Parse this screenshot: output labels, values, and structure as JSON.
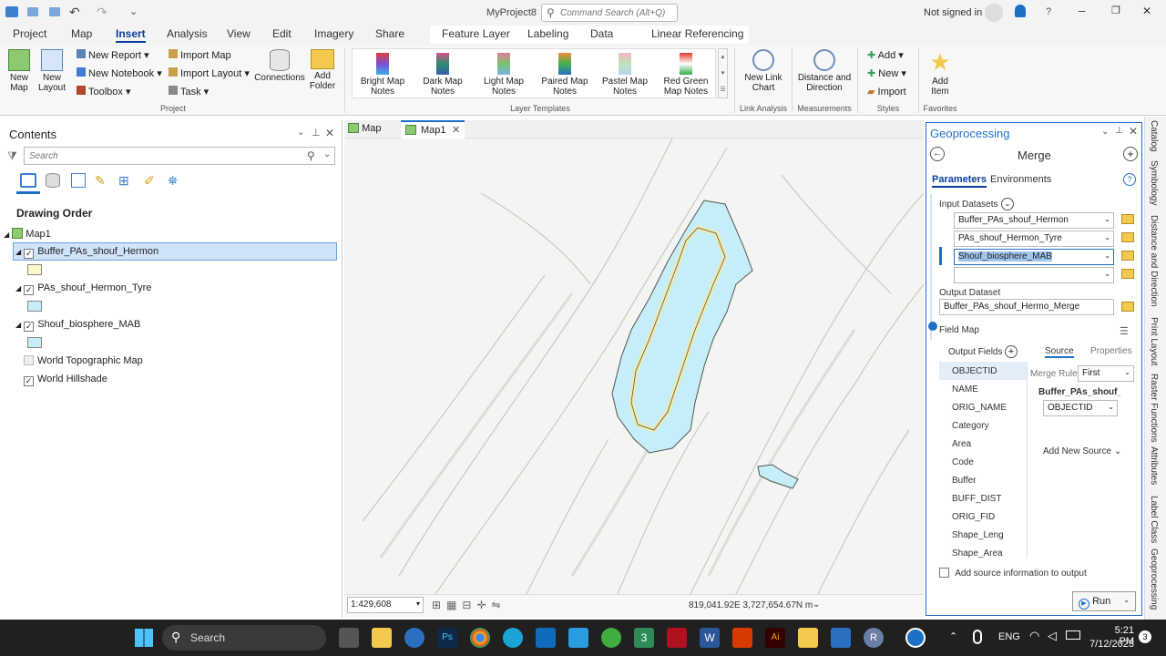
{
  "titlebar": {
    "project": "MyProject8",
    "search_placeholder": "Command Search (Alt+Q)",
    "signin": "Not signed in",
    "help": "?"
  },
  "tabs": [
    {
      "label": "Project"
    },
    {
      "label": "Map"
    },
    {
      "label": "Insert"
    },
    {
      "label": "Analysis"
    },
    {
      "label": "View"
    },
    {
      "label": "Edit"
    },
    {
      "label": "Imagery"
    },
    {
      "label": "Share"
    },
    {
      "label": "Feature Layer"
    },
    {
      "label": "Labeling"
    },
    {
      "label": "Data"
    },
    {
      "label": "Linear Referencing"
    }
  ],
  "ribbon": {
    "new_map": "New Map",
    "new_layout": "New Layout",
    "new_report": "New Report",
    "new_notebook": "New Notebook",
    "toolbox": "Toolbox",
    "import_map": "Import Map",
    "import_layout": "Import Layout",
    "task": "Task",
    "connections": "Connections",
    "add_folder": "Add Folder",
    "templates": [
      "Bright Map Notes",
      "Dark Map Notes",
      "Light Map Notes",
      "Paired Map Notes",
      "Pastel Map Notes",
      "Red Green Map Notes"
    ],
    "new_link_chart": "New Link Chart",
    "distance_direction": "Distance and Direction",
    "add": "Add",
    "new": "New",
    "import": "Import",
    "add_item": "Add Item",
    "groups": {
      "project": "Project",
      "layer_templates": "Layer Templates",
      "link_analysis": "Link Analysis",
      "measurements": "Measurements",
      "styles": "Styles",
      "favorites": "Favorites"
    }
  },
  "contents": {
    "title": "Contents",
    "search_placeholder": "Search",
    "drawing_order": "Drawing Order",
    "map_name": "Map1",
    "layers": [
      {
        "name": "Buffer_PAs_shouf_Hermon",
        "checked": "✓",
        "color": "#fdf8c9"
      },
      {
        "name": "PAs_shouf_Hermon_Tyre",
        "checked": "✓",
        "color": "#c6eef8"
      },
      {
        "name": "Shouf_biosphere_MAB",
        "checked": "✓",
        "color": "#c6eef8"
      },
      {
        "name": "World Topographic Map",
        "checked": ""
      },
      {
        "name": "World Hillshade",
        "checked": "✓"
      }
    ]
  },
  "map": {
    "tabs": [
      {
        "label": "Map"
      },
      {
        "label": "Map1"
      }
    ],
    "close_icon": "✕",
    "scale": "1:429,608",
    "coords": "819,041.92E 3,727,654.67N m"
  },
  "geo": {
    "title": "Geoprocessing",
    "tool": "Merge",
    "tab_params": "Parameters",
    "tab_env": "Environments",
    "input_label": "Input Datasets",
    "inputs": [
      "Buffer_PAs_shouf_Hermon",
      "PAs_shouf_Hermon_Tyre",
      "Shouf_biosphere_MAB",
      ""
    ],
    "output_label": "Output Dataset",
    "output_value": "Buffer_PAs_shouf_Hermo_Merge",
    "field_map": "Field Map",
    "output_fields": "Output Fields",
    "source": "Source",
    "properties": "Properties",
    "fields": [
      "OBJECTID",
      "NAME",
      "ORIG_NAME",
      "Category",
      "Area",
      "Code",
      "Buffer",
      "BUFF_DIST",
      "ORIG_FID",
      "Shape_Leng",
      "Shape_Area"
    ],
    "merge_rule_label": "Merge Rule",
    "merge_rule": "First",
    "source_layer": "Buffer_PAs_shouf_H",
    "source_field": "OBJECTID",
    "add_new_source": "Add New Source",
    "add_source_info": "Add source information to output",
    "run": "Run"
  },
  "strip": [
    "Catalog",
    "Symbology",
    "Distance and Direction",
    "Print Layout",
    "Raster Functions",
    "Attributes",
    "Label Class",
    "Geoprocessing"
  ],
  "taskbar": {
    "search": "Search",
    "lang": "ENG",
    "time": "5:21 PM",
    "date": "7/12/2023",
    "badge": "3"
  }
}
